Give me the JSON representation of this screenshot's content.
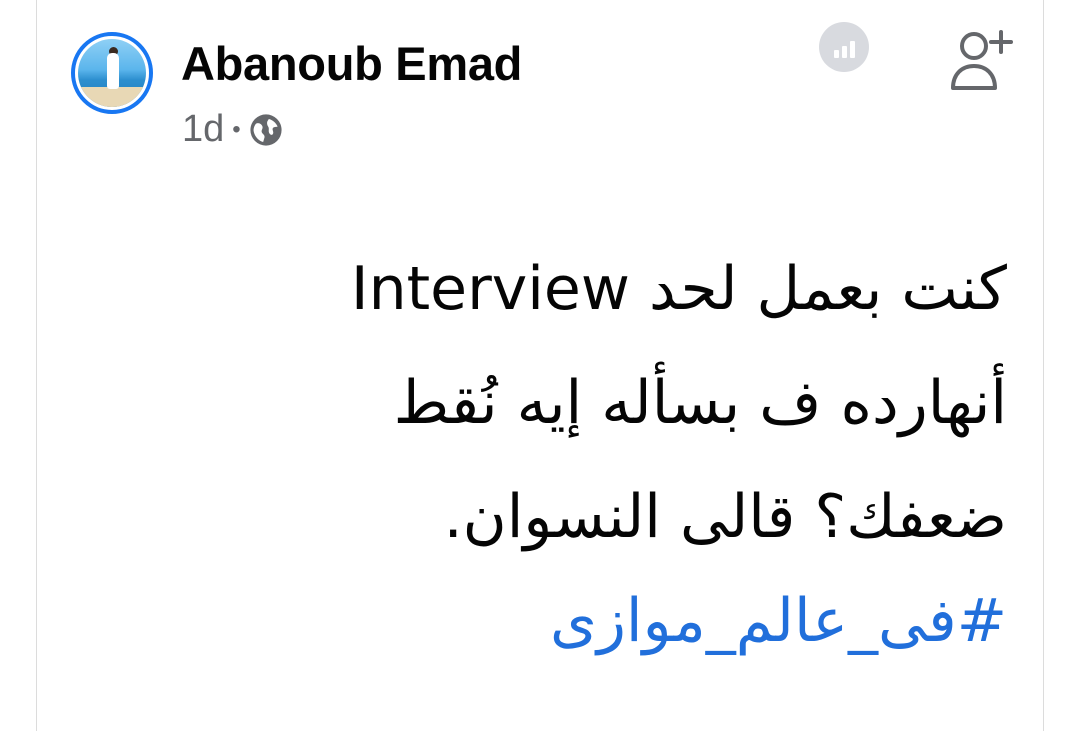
{
  "post": {
    "author": {
      "name": "Abanoub Emad",
      "avatar_icon": "profile-photo"
    },
    "meta": {
      "time": "1d",
      "separator": "•",
      "audience_icon": "globe-icon"
    },
    "actions": {
      "insights_icon": "bar-chart-icon",
      "add_friend_icon": "add-person-icon"
    },
    "text_lines": [
      "كنت بعمل لحد Interview",
      "أنهارده ف بسأله إيه نُقط",
      "ضعفك؟ قالى النسوان."
    ],
    "hashtag": "#فى_عالم_موازى"
  },
  "colors": {
    "accent": "#1877f2",
    "hashtag": "#216fdb",
    "secondary_text": "#65676b",
    "primary_text": "#050505"
  }
}
